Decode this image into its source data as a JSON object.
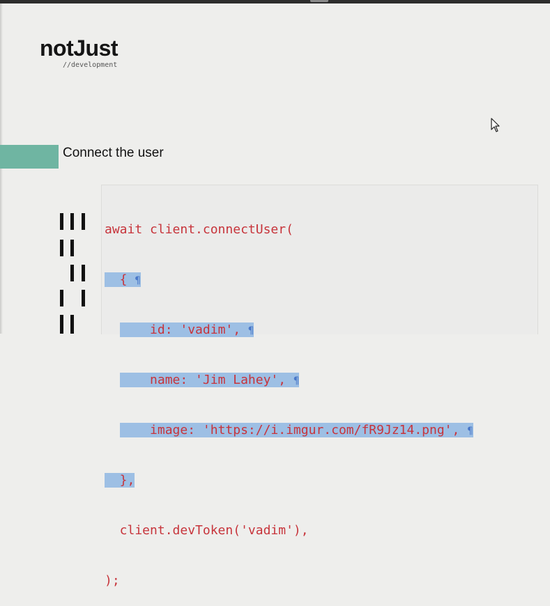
{
  "logo": {
    "name": "notJust",
    "tagline": "//development"
  },
  "section": {
    "title": "Connect the user"
  },
  "code": {
    "lines": [
      "await client.connectUser(",
      "  { ",
      "    id: 'vadim', ",
      "    name: 'Jim Lahey', ",
      "    image: 'https://i.imgur.com/fR9Jz14.png', ",
      "  },",
      "  client.devToken('vadim'),",
      ");"
    ],
    "pilcrow": "¶",
    "colors": {
      "text": "#c7343b",
      "selection": "#9dbfe4",
      "pilcrow": "#4a78c9"
    }
  },
  "colors": {
    "accent": "#6fb5a2",
    "background": "#eeeeec"
  },
  "icons": {
    "cursor": "mouse-pointer-icon"
  }
}
